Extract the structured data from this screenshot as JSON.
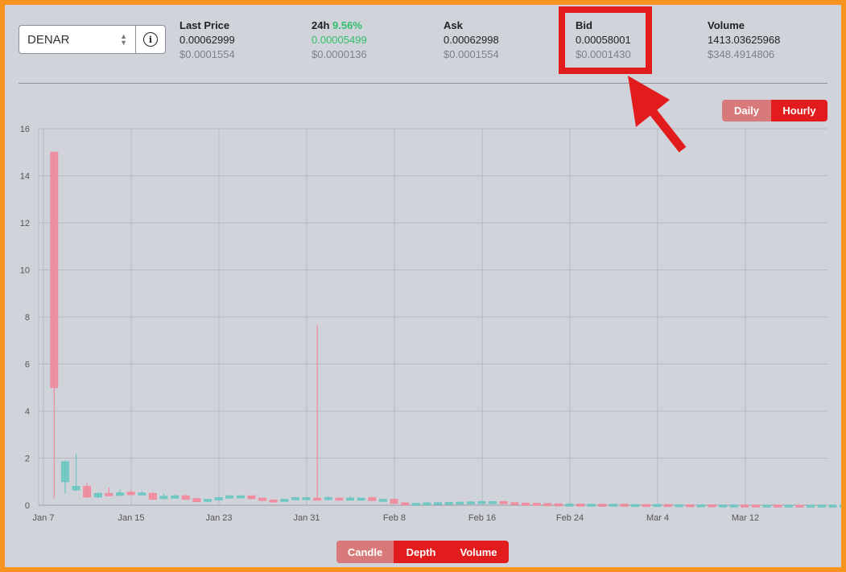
{
  "selector": {
    "value": "DENAR",
    "caret_icon": "chevron-updown-icon",
    "info_icon": "info-icon"
  },
  "stats": {
    "last_price": {
      "label": "Last Price",
      "value": "0.00062999",
      "usd": "$0.0001554"
    },
    "change24h": {
      "label": "24h",
      "pct": "9.56%",
      "value": "0.00005499",
      "usd": "$0.0000136"
    },
    "ask": {
      "label": "Ask",
      "value": "0.00062998",
      "usd": "$0.0001554"
    },
    "bid": {
      "label": "Bid",
      "value": "0.00058001",
      "usd": "$0.0001430"
    },
    "volume": {
      "label": "Volume",
      "value": "1413.03625968",
      "usd": "$348.4914806"
    }
  },
  "interval_toggle": {
    "daily": "Daily",
    "hourly": "Hourly",
    "selected": "Hourly"
  },
  "view_toggle": {
    "candle": "Candle",
    "depth": "Depth",
    "volume": "Volume"
  },
  "colors": {
    "up": "#6cc6c2",
    "down": "#f0899c",
    "accent": "#e21c1c",
    "highlight": "#e21c1c"
  },
  "annotation": {
    "box_target": "bid",
    "arrow": "arrow-icon"
  },
  "chart_data": {
    "type": "candlestick",
    "ylim": [
      0,
      16
    ],
    "yticks": [
      0,
      2,
      4,
      6,
      8,
      10,
      12,
      14,
      16
    ],
    "xlabels": [
      "Jan 7",
      "Jan 15",
      "Jan 23",
      "Jan 31",
      "Feb 8",
      "Feb 16",
      "Feb 24",
      "Mar 4",
      "Mar 12"
    ],
    "grid": true,
    "candles": [
      {
        "date": "Jan 8",
        "o": 15.0,
        "h": 15.0,
        "l": 0.3,
        "c": 5.0
      },
      {
        "date": "Jan 9",
        "o": 1.0,
        "h": 1.9,
        "l": 0.5,
        "c": 1.85
      },
      {
        "date": "Jan 10",
        "o": 0.65,
        "h": 2.2,
        "l": 0.6,
        "c": 0.8
      },
      {
        "date": "Jan 11",
        "o": 0.8,
        "h": 0.95,
        "l": 0.3,
        "c": 0.35
      },
      {
        "date": "Jan 12",
        "o": 0.35,
        "h": 0.55,
        "l": 0.3,
        "c": 0.5
      },
      {
        "date": "Jan 13",
        "o": 0.5,
        "h": 0.75,
        "l": 0.4,
        "c": 0.4
      },
      {
        "date": "Jan 14",
        "o": 0.42,
        "h": 0.65,
        "l": 0.4,
        "c": 0.52
      },
      {
        "date": "Jan 15",
        "o": 0.55,
        "h": 0.65,
        "l": 0.45,
        "c": 0.45
      },
      {
        "date": "Jan 16",
        "o": 0.48,
        "h": 0.6,
        "l": 0.45,
        "c": 0.52
      },
      {
        "date": "Jan 17",
        "o": 0.5,
        "h": 0.55,
        "l": 0.25,
        "c": 0.25
      },
      {
        "date": "Jan 18",
        "o": 0.28,
        "h": 0.5,
        "l": 0.25,
        "c": 0.38
      },
      {
        "date": "Jan 19",
        "o": 0.3,
        "h": 0.45,
        "l": 0.28,
        "c": 0.4
      },
      {
        "date": "Jan 20",
        "o": 0.4,
        "h": 0.45,
        "l": 0.25,
        "c": 0.25
      },
      {
        "date": "Jan 21",
        "o": 0.28,
        "h": 0.3,
        "l": 0.15,
        "c": 0.15
      },
      {
        "date": "Jan 22",
        "o": 0.18,
        "h": 0.28,
        "l": 0.15,
        "c": 0.25
      },
      {
        "date": "Jan 23",
        "o": 0.22,
        "h": 0.35,
        "l": 0.2,
        "c": 0.32
      },
      {
        "date": "Jan 24",
        "o": 0.3,
        "h": 0.42,
        "l": 0.28,
        "c": 0.4
      },
      {
        "date": "Jan 25",
        "o": 0.38,
        "h": 0.42,
        "l": 0.35,
        "c": 0.4
      },
      {
        "date": "Jan 26",
        "o": 0.4,
        "h": 0.42,
        "l": 0.25,
        "c": 0.28
      },
      {
        "date": "Jan 27",
        "o": 0.3,
        "h": 0.32,
        "l": 0.18,
        "c": 0.2
      },
      {
        "date": "Jan 28",
        "o": 0.22,
        "h": 0.25,
        "l": 0.18,
        "c": 0.2
      },
      {
        "date": "Jan 29",
        "o": 0.2,
        "h": 0.25,
        "l": 0.18,
        "c": 0.25
      },
      {
        "date": "Jan 30",
        "o": 0.25,
        "h": 0.35,
        "l": 0.22,
        "c": 0.32
      },
      {
        "date": "Jan 31",
        "o": 0.3,
        "h": 0.34,
        "l": 0.28,
        "c": 0.32
      },
      {
        "date": "Feb 1",
        "o": 0.3,
        "h": 7.65,
        "l": 0.25,
        "c": 0.28
      },
      {
        "date": "Feb 2",
        "o": 0.28,
        "h": 0.38,
        "l": 0.25,
        "c": 0.32
      },
      {
        "date": "Feb 3",
        "o": 0.3,
        "h": 0.32,
        "l": 0.25,
        "c": 0.28
      },
      {
        "date": "Feb 4",
        "o": 0.25,
        "h": 0.38,
        "l": 0.22,
        "c": 0.3
      },
      {
        "date": "Feb 5",
        "o": 0.28,
        "h": 0.32,
        "l": 0.25,
        "c": 0.3
      },
      {
        "date": "Feb 6",
        "o": 0.32,
        "h": 0.35,
        "l": 0.18,
        "c": 0.2
      },
      {
        "date": "Feb 7",
        "o": 0.2,
        "h": 0.28,
        "l": 0.18,
        "c": 0.25
      },
      {
        "date": "Feb 8",
        "o": 0.25,
        "h": 0.28,
        "l": 0.05,
        "c": 0.08
      },
      {
        "date": "Feb 9",
        "o": 0.1,
        "h": 0.12,
        "l": 0.05,
        "c": 0.06
      },
      {
        "date": "Feb 10",
        "o": 0.05,
        "h": 0.1,
        "l": 0.04,
        "c": 0.08
      },
      {
        "date": "Feb 11",
        "o": 0.08,
        "h": 0.12,
        "l": 0.06,
        "c": 0.1
      },
      {
        "date": "Feb 12",
        "o": 0.1,
        "h": 0.12,
        "l": 0.08,
        "c": 0.11
      },
      {
        "date": "Feb 13",
        "o": 0.11,
        "h": 0.13,
        "l": 0.09,
        "c": 0.12
      },
      {
        "date": "Feb 14",
        "o": 0.12,
        "h": 0.14,
        "l": 0.1,
        "c": 0.13
      },
      {
        "date": "Feb 15",
        "o": 0.12,
        "h": 0.16,
        "l": 0.1,
        "c": 0.14
      },
      {
        "date": "Feb 16",
        "o": 0.14,
        "h": 0.2,
        "l": 0.12,
        "c": 0.15
      },
      {
        "date": "Feb 17",
        "o": 0.14,
        "h": 0.16,
        "l": 0.12,
        "c": 0.15
      },
      {
        "date": "Feb 18",
        "o": 0.15,
        "h": 0.16,
        "l": 0.1,
        "c": 0.11
      },
      {
        "date": "Feb 19",
        "o": 0.11,
        "h": 0.12,
        "l": 0.08,
        "c": 0.09
      },
      {
        "date": "Feb 20",
        "o": 0.09,
        "h": 0.1,
        "l": 0.07,
        "c": 0.08
      },
      {
        "date": "Feb 21",
        "o": 0.08,
        "h": 0.09,
        "l": 0.06,
        "c": 0.07
      },
      {
        "date": "Feb 22",
        "o": 0.07,
        "h": 0.08,
        "l": 0.05,
        "c": 0.06
      },
      {
        "date": "Feb 23",
        "o": 0.06,
        "h": 0.07,
        "l": 0.05,
        "c": 0.05
      },
      {
        "date": "Feb 24",
        "o": 0.05,
        "h": 0.06,
        "l": 0.04,
        "c": 0.05
      },
      {
        "date": "Feb 25",
        "o": 0.05,
        "h": 0.06,
        "l": 0.04,
        "c": 0.04
      },
      {
        "date": "Feb 26",
        "o": 0.04,
        "h": 0.05,
        "l": 0.03,
        "c": 0.04
      },
      {
        "date": "Feb 27",
        "o": 0.04,
        "h": 0.05,
        "l": 0.03,
        "c": 0.03
      },
      {
        "date": "Feb 28",
        "o": 0.03,
        "h": 0.05,
        "l": 0.03,
        "c": 0.04
      },
      {
        "date": "Mar 1",
        "o": 0.04,
        "h": 0.05,
        "l": 0.03,
        "c": 0.03
      },
      {
        "date": "Mar 2",
        "o": 0.03,
        "h": 0.04,
        "l": 0.02,
        "c": 0.03
      },
      {
        "date": "Mar 3",
        "o": 0.03,
        "h": 0.04,
        "l": 0.02,
        "c": 0.02
      },
      {
        "date": "Mar 4",
        "o": 0.02,
        "h": 0.04,
        "l": 0.02,
        "c": 0.03
      },
      {
        "date": "Mar 5",
        "o": 0.03,
        "h": 0.035,
        "l": 0.02,
        "c": 0.02
      },
      {
        "date": "Mar 6",
        "o": 0.02,
        "h": 0.03,
        "l": 0.015,
        "c": 0.02
      },
      {
        "date": "Mar 7",
        "o": 0.02,
        "h": 0.03,
        "l": 0.015,
        "c": 0.015
      },
      {
        "date": "Mar 8",
        "o": 0.015,
        "h": 0.02,
        "l": 0.01,
        "c": 0.015
      },
      {
        "date": "Mar 9",
        "o": 0.015,
        "h": 0.02,
        "l": 0.01,
        "c": 0.01
      },
      {
        "date": "Mar 10",
        "o": 0.01,
        "h": 0.015,
        "l": 0.01,
        "c": 0.01
      },
      {
        "date": "Mar 11",
        "o": 0.01,
        "h": 0.015,
        "l": 0.008,
        "c": 0.01
      },
      {
        "date": "Mar 12",
        "o": 0.01,
        "h": 0.012,
        "l": 0.008,
        "c": 0.009
      },
      {
        "date": "Mar 13",
        "o": 0.009,
        "h": 0.012,
        "l": 0.007,
        "c": 0.008
      },
      {
        "date": "Mar 14",
        "o": 0.008,
        "h": 0.01,
        "l": 0.006,
        "c": 0.008
      },
      {
        "date": "Mar 15",
        "o": 0.008,
        "h": 0.01,
        "l": 0.006,
        "c": 0.007
      },
      {
        "date": "Mar 16",
        "o": 0.007,
        "h": 0.009,
        "l": 0.006,
        "c": 0.007
      },
      {
        "date": "Mar 17",
        "o": 0.007,
        "h": 0.009,
        "l": 0.006,
        "c": 0.006
      },
      {
        "date": "Mar 18",
        "o": 0.006,
        "h": 0.008,
        "l": 0.005,
        "c": 0.006
      },
      {
        "date": "Mar 19",
        "o": 0.006,
        "h": 0.008,
        "l": 0.005,
        "c": 0.006
      },
      {
        "date": "Mar 20",
        "o": 0.006,
        "h": 0.007,
        "l": 0.005,
        "c": 0.006
      },
      {
        "date": "Mar 21",
        "o": 0.006,
        "h": 0.007,
        "l": 0.005,
        "c": 0.006
      }
    ]
  }
}
